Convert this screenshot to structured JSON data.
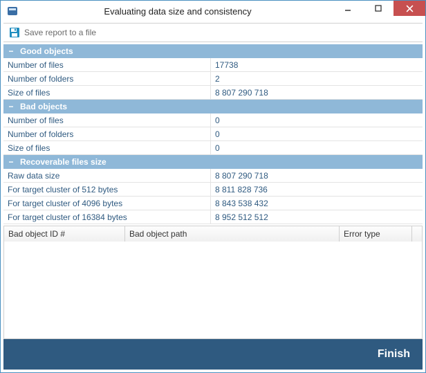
{
  "window": {
    "title": "Evaluating data size and consistency"
  },
  "toolbar": {
    "save_report_label": "Save report to a file"
  },
  "sections": {
    "good": {
      "title": "Good objects",
      "rows": {
        "num_files_label": "Number of files",
        "num_files_value": "17738",
        "num_folders_label": "Number of folders",
        "num_folders_value": "2",
        "size_files_label": "Size of files",
        "size_files_value": "8 807 290 718"
      }
    },
    "bad": {
      "title": "Bad objects",
      "rows": {
        "num_files_label": "Number of files",
        "num_files_value": "0",
        "num_folders_label": "Number of folders",
        "num_folders_value": "0",
        "size_files_label": "Size of files",
        "size_files_value": "0"
      }
    },
    "recoverable": {
      "title": "Recoverable files size",
      "rows": {
        "raw_label": "Raw data size",
        "raw_value": "8 807 290 718",
        "c512_label": "For target cluster of 512 bytes",
        "c512_value": "8 811 828 736",
        "c4096_label": "For target cluster of 4096 bytes",
        "c4096_value": "8 843 538 432",
        "c16384_label": "For target cluster of 16384 bytes",
        "c16384_value": "8 952 512 512"
      }
    }
  },
  "grid": {
    "columns": {
      "id": "Bad object ID #",
      "path": "Bad object path",
      "error": "Error type"
    }
  },
  "footer": {
    "finish_label": "Finish"
  },
  "collapse_glyph": "−"
}
